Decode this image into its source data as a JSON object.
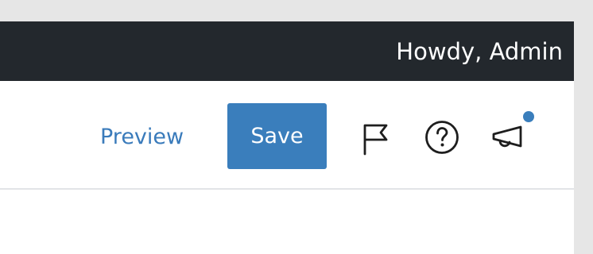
{
  "admin_bar": {
    "greeting": "Howdy, Admin",
    "background_color": "#23282d"
  },
  "toolbar": {
    "preview_label": "Preview",
    "save_label": "Save",
    "accent_color": "#3a7ebc",
    "icons": [
      "flag-icon",
      "help-icon",
      "megaphone-icon"
    ],
    "announcements_notification": true
  }
}
